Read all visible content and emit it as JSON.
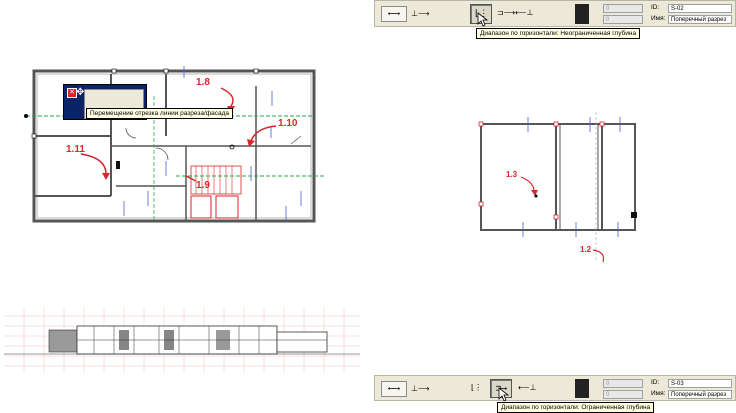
{
  "toolbar_top": {
    "tooltip": "Диапазон по горизонтали: Неограниченная глубина",
    "id_label": "ID:",
    "id_value": "S-02",
    "name_label": "Имя:",
    "name_value": "Поперечный разрез",
    "coord_a": "0",
    "coord_b": "0"
  },
  "toolbar_bottom": {
    "tooltip": "Диапазон по горизонтали: Ограниченная глубина",
    "id_label": "ID:",
    "id_value": "S-03",
    "name_label": "Имя:",
    "name_value": "Поперечный разрез",
    "coord_a": "0",
    "coord_b": "0"
  },
  "plan_top_left": {
    "tooltip": "Перемещение отрезка линии разреза/фасада",
    "annotations": [
      "1.8",
      "1.10",
      "1.11",
      "1.9"
    ]
  },
  "plan_right": {
    "annotations": [
      "1.3",
      "1.2"
    ]
  },
  "colors": {
    "accent_red": "#d8262b",
    "wall": "#555555",
    "toolbar_bg": "#ece9d8",
    "tooltip_bg": "#ffffe1",
    "dialog_title": "#0a246a"
  }
}
